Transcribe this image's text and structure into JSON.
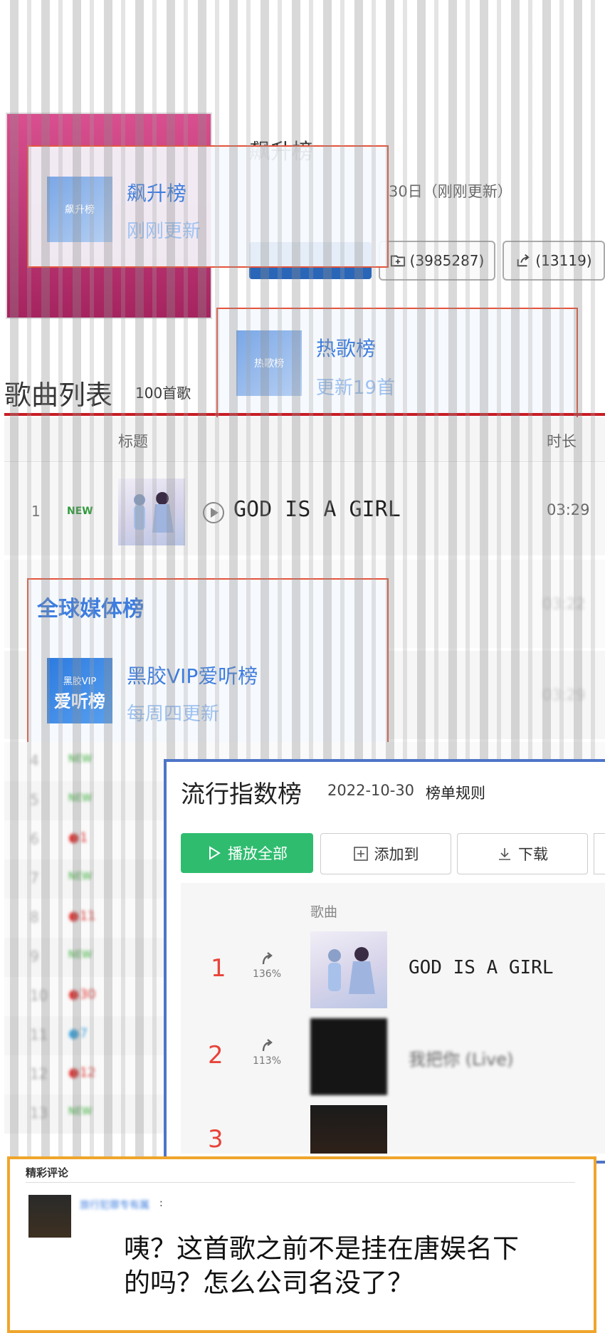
{
  "chart_header": {
    "title": "飙升榜",
    "updated": "30日（刚刚更新）",
    "collect_count": "(3985287)",
    "share_count": "(13119)"
  },
  "cards": {
    "soaring": {
      "thumb": "飙升榜",
      "title": "飙升榜",
      "subtitle": "刚刚更新"
    },
    "hot": {
      "thumb": "热歌榜",
      "title": "热歌榜",
      "subtitle": "更新19首"
    },
    "global": {
      "heading": "全球媒体榜",
      "thumb_top": "黑胶VIP",
      "thumb_bottom": "爱听榜",
      "title": "黑胶VIP爱听榜",
      "subtitle": "每周四更新"
    }
  },
  "song_list": {
    "heading": "歌曲列表",
    "count": "100首歌",
    "columns": {
      "title": "标题",
      "duration": "时长"
    },
    "first_row": {
      "index": "1",
      "badge": "NEW",
      "title": "GOD IS A GIRL",
      "duration": "03:29"
    },
    "faded_durations": [
      "03:22",
      "03:29"
    ],
    "faded_rows": [
      {
        "index": "4",
        "badge": "NEW"
      },
      {
        "index": "5",
        "badge": "NEW"
      },
      {
        "index": "6",
        "badge": "●1"
      },
      {
        "index": "7",
        "badge": "NEW"
      },
      {
        "index": "8",
        "badge": "●11"
      },
      {
        "index": "9",
        "badge": "NEW"
      },
      {
        "index": "10",
        "badge": "●30"
      },
      {
        "index": "11",
        "badge": "●7"
      },
      {
        "index": "12",
        "badge": "●12"
      },
      {
        "index": "13",
        "badge": "NEW"
      }
    ]
  },
  "popularity_panel": {
    "title": "流行指数榜",
    "date": "2022-10-30",
    "rules_link": "榜单规则",
    "buttons": {
      "play_all": "播放全部",
      "add_to": "添加到",
      "download": "下载"
    },
    "column_song": "歌曲",
    "rows": [
      {
        "rank": "1",
        "change": "136%",
        "title": "GOD IS A GIRL"
      },
      {
        "rank": "2",
        "change": "113%",
        "title": "我把你 (Live)"
      },
      {
        "rank": "3",
        "change": "",
        "title": ""
      }
    ]
  },
  "comments": {
    "heading": "精彩评论",
    "username": "旅行犯罪专有属",
    "text_line1": "咦？这首歌之前不是挂在唐娱名下",
    "text_line2": "的吗？怎么公司名没了？"
  },
  "colors": {
    "accent_blue": "#3d7de0",
    "netease_red": "#c81d25",
    "qq_green": "#2fbc6f",
    "card_border_red": "#e5543b",
    "panel_border_blue": "#4d75c8",
    "comment_border_orange": "#efa52c"
  }
}
